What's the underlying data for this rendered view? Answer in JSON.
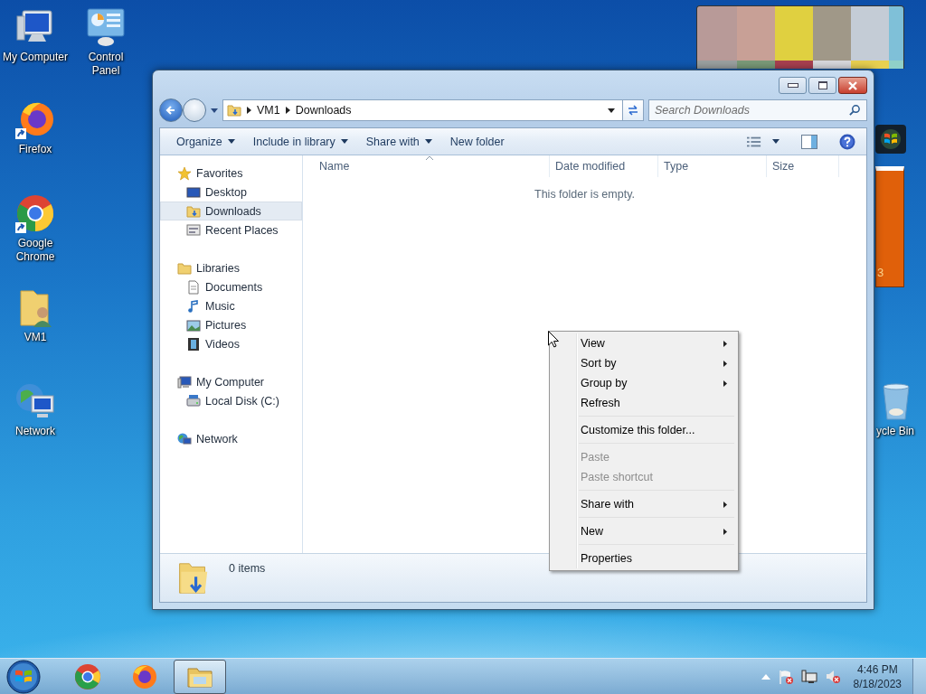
{
  "desktop_icons": [
    {
      "label": "My Computer",
      "kind": "computer",
      "shortcut": false
    },
    {
      "label": "Control Panel",
      "kind": "control_panel",
      "shortcut": false
    },
    {
      "label": "Firefox",
      "kind": "firefox",
      "shortcut": true
    },
    {
      "label": "Google Chrome",
      "kind": "chrome",
      "shortcut": true
    },
    {
      "label": "VM1",
      "kind": "user_folder",
      "shortcut": false
    },
    {
      "label": "Network",
      "kind": "network",
      "shortcut": false
    },
    {
      "label": "ycle Bin",
      "kind": "recycle_bin",
      "shortcut": false
    }
  ],
  "gadgets": {
    "calendar": {
      "footer": "3"
    }
  },
  "window": {
    "address": {
      "breadcrumb": [
        "VM1",
        "Downloads"
      ]
    },
    "search": {
      "placeholder": "Search Downloads"
    },
    "toolbar": [
      {
        "label": "Organize",
        "dropdown": true
      },
      {
        "label": "Include in library",
        "dropdown": true
      },
      {
        "label": "Share with",
        "dropdown": true
      },
      {
        "label": "New folder",
        "dropdown": false
      }
    ],
    "nav": [
      {
        "label": "Favorites",
        "kind": "star",
        "selected": false,
        "children": [
          {
            "label": "Desktop",
            "kind": "desktop",
            "selected": false
          },
          {
            "label": "Downloads",
            "kind": "downloads",
            "selected": true
          },
          {
            "label": "Recent Places",
            "kind": "recent",
            "selected": false
          }
        ]
      },
      {
        "label": "Libraries",
        "kind": "library",
        "selected": false,
        "children": [
          {
            "label": "Documents",
            "kind": "documents",
            "selected": false
          },
          {
            "label": "Music",
            "kind": "music",
            "selected": false
          },
          {
            "label": "Pictures",
            "kind": "pictures",
            "selected": false
          },
          {
            "label": "Videos",
            "kind": "videos",
            "selected": false
          }
        ]
      },
      {
        "label": "My Computer",
        "kind": "computer",
        "selected": false,
        "children": [
          {
            "label": "Local Disk (C:)",
            "kind": "disk",
            "selected": false
          }
        ]
      },
      {
        "label": "Network",
        "kind": "network",
        "selected": false
      }
    ],
    "columns": [
      {
        "label": "Name",
        "sorted": true
      },
      {
        "label": "Date modified",
        "sorted": false
      },
      {
        "label": "Type",
        "sorted": false
      },
      {
        "label": "Size",
        "sorted": false
      }
    ],
    "empty_message": "This folder is empty.",
    "status": "0 items"
  },
  "context_menu": [
    {
      "label": "View",
      "submenu": true,
      "disabled": false,
      "separator_before": false
    },
    {
      "label": "Sort by",
      "submenu": true,
      "disabled": false,
      "separator_before": false
    },
    {
      "label": "Group by",
      "submenu": true,
      "disabled": false,
      "separator_before": false
    },
    {
      "label": "Refresh",
      "submenu": false,
      "disabled": false,
      "separator_before": false
    },
    {
      "label": "Customize this folder...",
      "submenu": false,
      "disabled": false,
      "separator_before": true
    },
    {
      "label": "Paste",
      "submenu": false,
      "disabled": true,
      "separator_before": true
    },
    {
      "label": "Paste shortcut",
      "submenu": false,
      "disabled": true,
      "separator_before": false
    },
    {
      "label": "Share with",
      "submenu": true,
      "disabled": false,
      "separator_before": true
    },
    {
      "label": "New",
      "submenu": true,
      "disabled": false,
      "separator_before": true
    },
    {
      "label": "Properties",
      "submenu": false,
      "disabled": false,
      "separator_before": true
    }
  ],
  "taskbar": {
    "apps": [
      {
        "kind": "chrome",
        "active": false
      },
      {
        "kind": "firefox",
        "active": false
      },
      {
        "kind": "explorer",
        "active": true
      }
    ],
    "time": "4:46 PM",
    "date": "8/18/2023"
  }
}
